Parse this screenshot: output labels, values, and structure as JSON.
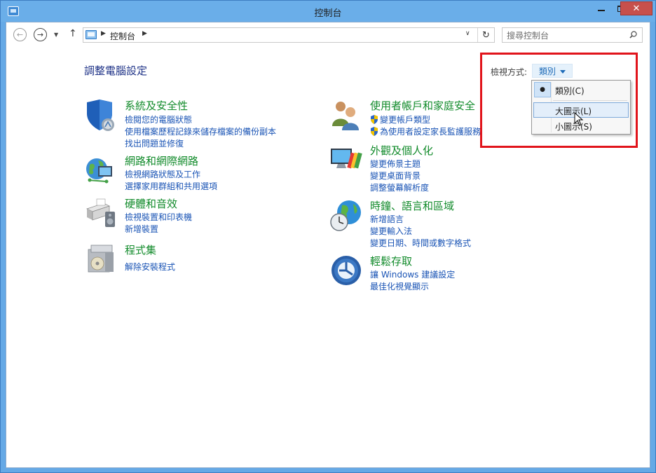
{
  "window": {
    "title": "控制台"
  },
  "nav": {
    "breadcrumb": "控制台",
    "search_placeholder": "搜尋控制台"
  },
  "main": {
    "page_title": "調整電腦設定",
    "view_by_label": "檢視方式:",
    "view_by_value": "類別",
    "menu": {
      "items": [
        "類別(C)",
        "大圖示(L)",
        "小圖示(S)"
      ],
      "checked": "類別(C)",
      "hover": "大圖示(L)"
    }
  },
  "categories": {
    "security": {
      "title": "系統及安全性",
      "links": [
        "檢閱您的電腦狀態",
        "使用檔案歷程記錄來儲存檔案的備份副本",
        "找出問題並修復"
      ]
    },
    "network": {
      "title": "網路和網際網路",
      "links": [
        "檢視網路狀態及工作",
        "選擇家用群組和共用選項"
      ]
    },
    "hardware": {
      "title": "硬體和音效",
      "links": [
        "檢視裝置和印表機",
        "新增裝置"
      ]
    },
    "programs": {
      "title": "程式集",
      "links": [
        "解除安裝程式"
      ]
    },
    "users": {
      "title": "使用者帳戶和家庭安全",
      "links": [
        "變更帳戶類型",
        "為使用者設定家長監護服務"
      ]
    },
    "appearance": {
      "title": "外觀及個人化",
      "links": [
        "變更佈景主題",
        "變更桌面背景",
        "調整螢幕解析度"
      ]
    },
    "clock": {
      "title": "時鐘、語言和區域",
      "links": [
        "新增語言",
        "變更輸入法",
        "變更日期、時間或數字格式"
      ]
    },
    "ease": {
      "title": "輕鬆存取",
      "links": [
        "讓 Windows 建議設定",
        "最佳化視覺顯示"
      ]
    }
  },
  "colors": {
    "titlebar": "#6aaee9",
    "category_title": "#128b2b",
    "link": "#1a54b5",
    "highlight": "#e1141b"
  }
}
